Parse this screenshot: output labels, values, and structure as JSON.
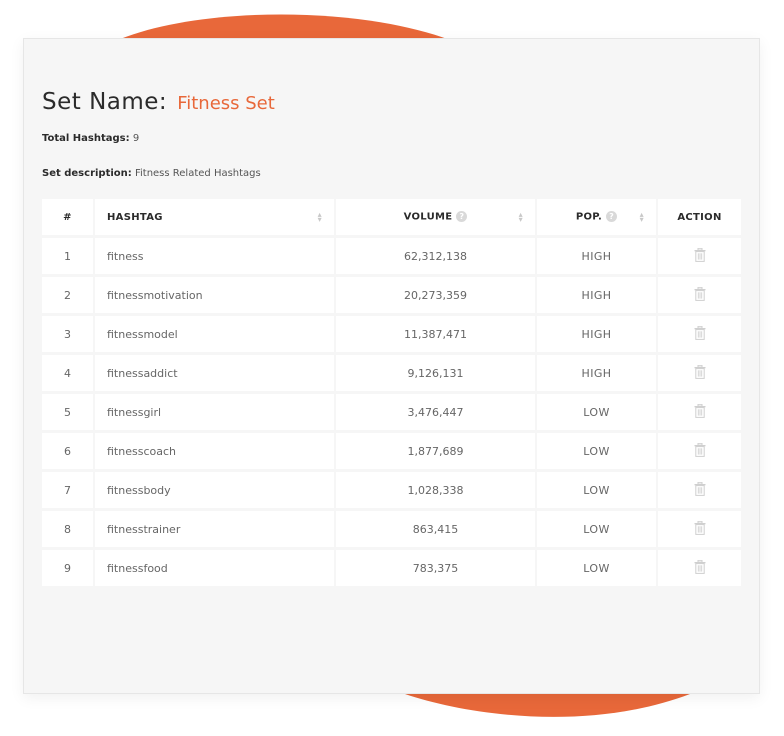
{
  "header": {
    "title_label": "Set Name:",
    "set_name": "Fitness Set",
    "total_label": "Total Hashtags:",
    "total_value": "9",
    "desc_label": "Set description:",
    "desc_value": "Fitness Related Hashtags"
  },
  "table": {
    "columns": {
      "num": "#",
      "hashtag": "HASHTAG",
      "volume": "VOLUME",
      "pop": "POP.",
      "action": "ACTION"
    },
    "rows": [
      {
        "num": "1",
        "hashtag": "fitness",
        "volume": "62,312,138",
        "pop": "HIGH"
      },
      {
        "num": "2",
        "hashtag": "fitnessmotivation",
        "volume": "20,273,359",
        "pop": "HIGH"
      },
      {
        "num": "3",
        "hashtag": "fitnessmodel",
        "volume": "11,387,471",
        "pop": "HIGH"
      },
      {
        "num": "4",
        "hashtag": "fitnessaddict",
        "volume": "9,126,131",
        "pop": "HIGH"
      },
      {
        "num": "5",
        "hashtag": "fitnessgirl",
        "volume": "3,476,447",
        "pop": "LOW"
      },
      {
        "num": "6",
        "hashtag": "fitnesscoach",
        "volume": "1,877,689",
        "pop": "LOW"
      },
      {
        "num": "7",
        "hashtag": "fitnessbody",
        "volume": "1,028,338",
        "pop": "LOW"
      },
      {
        "num": "8",
        "hashtag": "fitnesstrainer",
        "volume": "863,415",
        "pop": "LOW"
      },
      {
        "num": "9",
        "hashtag": "fitnessfood",
        "volume": "783,375",
        "pop": "LOW"
      }
    ]
  },
  "icons": {
    "sort": "sort-icon",
    "help": "help-icon",
    "delete": "trash-icon"
  },
  "colors": {
    "accent": "#e8683a",
    "card_bg": "#f6f6f6",
    "icon_gray": "#cfcfcf"
  }
}
